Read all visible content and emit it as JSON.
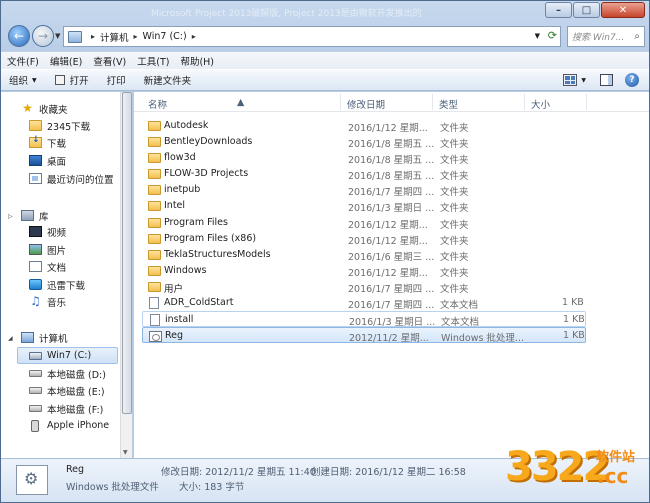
{
  "title_text": "Microsoft Project 2013破解版, Project 2013是由微软开发推出的",
  "address": {
    "crumbs": [
      "计算机",
      "Win7 (C:)"
    ],
    "search_placeholder": "搜索 Win7..."
  },
  "menu": [
    "文件(F)",
    "编辑(E)",
    "查看(V)",
    "工具(T)",
    "帮助(H)"
  ],
  "toolbar": {
    "organize": "组织",
    "open": "打开",
    "print": "打印",
    "new_folder": "新建文件夹"
  },
  "nav": {
    "favorites": "收藏夹",
    "fav_items": [
      "2345下载",
      "下载",
      "桌面",
      "最近访问的位置"
    ],
    "libraries": "库",
    "lib_items": [
      "视频",
      "图片",
      "文档",
      "迅雷下载",
      "音乐"
    ],
    "computer": "计算机",
    "drives": [
      "Win7 (C:)",
      "本地磁盘 (D:)",
      "本地磁盘 (E:)",
      "本地磁盘 (F:)",
      "Apple iPhone"
    ]
  },
  "columns": {
    "name": "名称",
    "date": "修改日期",
    "type": "类型",
    "size": "大小"
  },
  "files": [
    {
      "name": "Autodesk",
      "date": "2016/1/12 星期...",
      "type": "文件夹",
      "size": ""
    },
    {
      "name": "BentleyDownloads",
      "date": "2016/1/8 星期五 ...",
      "type": "文件夹",
      "size": ""
    },
    {
      "name": "flow3d",
      "date": "2016/1/8 星期五 ...",
      "type": "文件夹",
      "size": ""
    },
    {
      "name": "FLOW-3D Projects",
      "date": "2016/1/8 星期五 ...",
      "type": "文件夹",
      "size": ""
    },
    {
      "name": "inetpub",
      "date": "2016/1/7 星期四 ...",
      "type": "文件夹",
      "size": ""
    },
    {
      "name": "Intel",
      "date": "2016/1/3 星期日 ...",
      "type": "文件夹",
      "size": ""
    },
    {
      "name": "Program Files",
      "date": "2016/1/12 星期...",
      "type": "文件夹",
      "size": ""
    },
    {
      "name": "Program Files (x86)",
      "date": "2016/1/12 星期...",
      "type": "文件夹",
      "size": ""
    },
    {
      "name": "TeklaStructuresModels",
      "date": "2016/1/6 星期三 ...",
      "type": "文件夹",
      "size": ""
    },
    {
      "name": "Windows",
      "date": "2016/1/12 星期...",
      "type": "文件夹",
      "size": ""
    },
    {
      "name": "用户",
      "date": "2016/1/7 星期四 ...",
      "type": "文件夹",
      "size": ""
    },
    {
      "name": "ADR_ColdStart",
      "date": "2016/1/7 星期四 ...",
      "type": "文本文档",
      "size": "1 KB"
    },
    {
      "name": "install",
      "date": "2016/1/3 星期日 ...",
      "type": "文本文档",
      "size": "1 KB"
    },
    {
      "name": "Reg",
      "date": "2012/11/2 星期...",
      "type": "Windows 批处理...",
      "size": "1 KB"
    }
  ],
  "details": {
    "name": "Reg",
    "type": "Windows 批处理文件",
    "modified_label": "修改日期: 2012/11/2 星期五 11:40",
    "created_label": "创建日期: 2016/1/12 星期二 16:58",
    "size_label": "大小: 183 字节"
  },
  "watermark": {
    "digits": "3322",
    "cc": ".cc",
    "zh": "软件站"
  },
  "colors": {
    "frame": "#b6cbe6",
    "selection": "#d4e6fa",
    "folder": "#f2c14e"
  }
}
